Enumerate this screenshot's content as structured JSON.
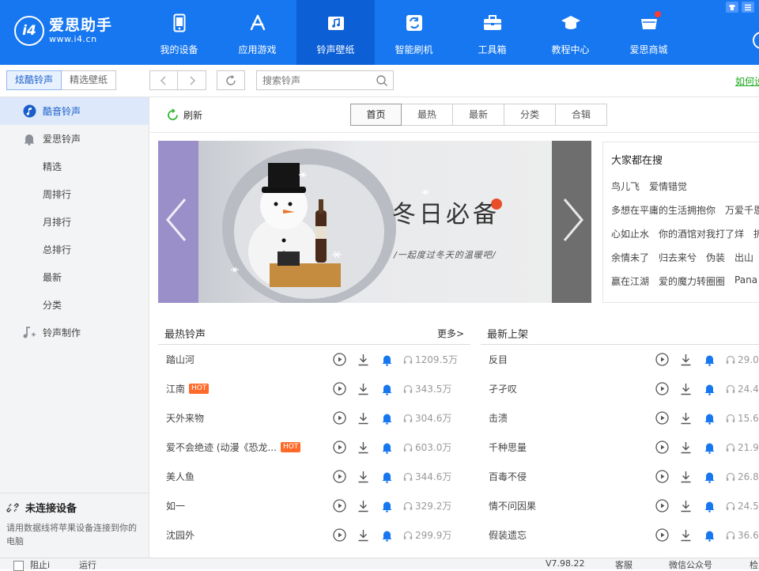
{
  "app": {
    "logo_mark": "i4",
    "logo_name": "爱思助手",
    "logo_url": "www.i4.cn"
  },
  "nav": [
    {
      "label": "我的设备",
      "icon": "phone-icon"
    },
    {
      "label": "应用游戏",
      "icon": "app-store-icon"
    },
    {
      "label": "铃声壁纸",
      "icon": "music-icon"
    },
    {
      "label": "智能刷机",
      "icon": "flash-icon"
    },
    {
      "label": "工具箱",
      "icon": "toolbox-icon"
    },
    {
      "label": "教程中心",
      "icon": "graduation-cap-icon"
    },
    {
      "label": "爱思商城",
      "icon": "shop-icon"
    }
  ],
  "toolbar": {
    "seg_ringtones": "炫酷铃声",
    "seg_wallpapers": "精选壁纸",
    "search_placeholder": "搜索铃声",
    "help_link": "如何设"
  },
  "sidebar": {
    "items": [
      {
        "label": "酷音铃声"
      },
      {
        "label": "爱思铃声"
      },
      {
        "label": "精选"
      },
      {
        "label": "周排行"
      },
      {
        "label": "月排行"
      },
      {
        "label": "总排行"
      },
      {
        "label": "最新"
      },
      {
        "label": "分类"
      },
      {
        "label": "铃声制作"
      }
    ],
    "device_title": "未连接设备",
    "device_desc": "请用数据线将苹果设备连接到你的电脑"
  },
  "main": {
    "refresh_label": "刷新",
    "tabs": [
      "首页",
      "最热",
      "最新",
      "分类",
      "合辑"
    ],
    "banner": {
      "title": "冬日必备",
      "subtitle": "/一起度过冬天的温暖吧/"
    },
    "hot_search": {
      "title": "大家都在搜",
      "rows": [
        [
          "鸟儿飞",
          "爱情错觉"
        ],
        [
          "多想在平庸的生活拥抱你",
          "万爱千恩"
        ],
        [
          "心如止水",
          "你的酒馆对我打了烊",
          "拆"
        ],
        [
          "余情未了",
          "归去来兮",
          "伪装",
          "出山"
        ],
        [
          "赢在江湖",
          "爱的魔力转圈圈",
          "Pana"
        ]
      ]
    },
    "hottest": {
      "title": "最热铃声",
      "more": "更多>",
      "songs": [
        {
          "title": "踏山河",
          "hot": false,
          "count": "1209.5万"
        },
        {
          "title": "江南",
          "hot": true,
          "count": "343.5万"
        },
        {
          "title": "天外来物",
          "hot": false,
          "count": "304.6万"
        },
        {
          "title": "爱不会绝迹 (动漫《恐龙...",
          "hot": true,
          "count": "603.0万"
        },
        {
          "title": "美人鱼",
          "hot": false,
          "count": "344.6万"
        },
        {
          "title": "如一",
          "hot": false,
          "count": "329.2万"
        },
        {
          "title": "沈园外",
          "hot": false,
          "count": "299.9万"
        }
      ],
      "hot_label": "HOT"
    },
    "newest": {
      "title": "最新上架",
      "songs": [
        {
          "title": "反目",
          "count": "29.0"
        },
        {
          "title": "孑孑叹",
          "count": "24.4"
        },
        {
          "title": "击溃",
          "count": "15.6"
        },
        {
          "title": "千种思量",
          "count": "21.9"
        },
        {
          "title": "百毒不侵",
          "count": "26.8"
        },
        {
          "title": "情不问因果",
          "count": "24.5"
        },
        {
          "title": "假装遗忘",
          "count": "36.6"
        }
      ]
    }
  },
  "status": {
    "left1": "阻止i",
    "left2": "运行",
    "r1": "V7.98.22",
    "r2": "客服",
    "r3": "微信公众号",
    "r4": "检"
  },
  "colors": {
    "brand_blue": "#1677f0",
    "active_nav": "#0d5fd6",
    "hot_badge": "#ff6a2a",
    "help_green": "#1aaa1a",
    "bell_blue": "#1677f0"
  }
}
